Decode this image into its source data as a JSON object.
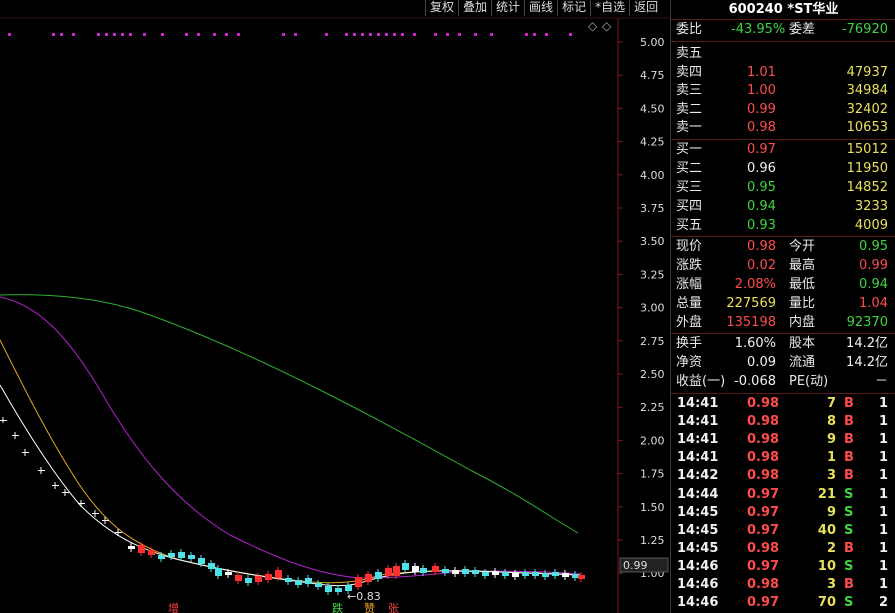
{
  "toolbar": [
    "复权",
    "叠加",
    "统计",
    "画线",
    "标记",
    "*自选",
    "返回"
  ],
  "chart_data": {
    "type": "line",
    "y_ticks": [
      "5.00",
      "4.75",
      "4.50",
      "4.25",
      "4.00",
      "3.75",
      "3.50",
      "3.25",
      "3.00",
      "2.75",
      "2.50",
      "2.25",
      "2.00",
      "1.75",
      "1.50",
      "1.25",
      "1.00"
    ],
    "current_price_label": "0.99",
    "low_marker": "←0.83",
    "bottom_tags": [
      "增",
      "跌",
      "赞",
      "张"
    ]
  },
  "header": {
    "code": "600240",
    "name": "*ST华业"
  },
  "weibi": {
    "label1": "委比",
    "value1": "-43.95%",
    "label2": "委差",
    "value2": "-76920"
  },
  "asks": [
    {
      "label": "卖五",
      "price": "",
      "vol": ""
    },
    {
      "label": "卖四",
      "price": "1.01",
      "vol": "47937"
    },
    {
      "label": "卖三",
      "price": "1.00",
      "vol": "34984"
    },
    {
      "label": "卖二",
      "price": "0.99",
      "vol": "32402"
    },
    {
      "label": "卖一",
      "price": "0.98",
      "vol": "10653"
    }
  ],
  "bids": [
    {
      "label": "买一",
      "price": "0.97",
      "vol": "15012"
    },
    {
      "label": "买二",
      "price": "0.96",
      "vol": "11950"
    },
    {
      "label": "买三",
      "price": "0.95",
      "vol": "14852"
    },
    {
      "label": "买四",
      "price": "0.94",
      "vol": "3233"
    },
    {
      "label": "买五",
      "price": "0.93",
      "vol": "4009"
    }
  ],
  "stats": [
    {
      "l1": "现价",
      "v1": "0.98",
      "l2": "今开",
      "v2": "0.95"
    },
    {
      "l1": "涨跌",
      "v1": "0.02",
      "l2": "最高",
      "v2": "0.99"
    },
    {
      "l1": "涨幅",
      "v1": "2.08%",
      "l2": "最低",
      "v2": "0.94"
    },
    {
      "l1": "总量",
      "v1": "227569",
      "l2": "量比",
      "v2": "1.04"
    },
    {
      "l1": "外盘",
      "v1": "135198",
      "l2": "内盘",
      "v2": "92370"
    }
  ],
  "stats2": [
    {
      "l1": "换手",
      "v1": "1.60%",
      "l2": "股本",
      "v2": "14.2亿"
    },
    {
      "l1": "净资",
      "v1": "0.09",
      "l2": "流通",
      "v2": "14.2亿"
    },
    {
      "l1": "收益(一)",
      "v1": "-0.068",
      "l2": "PE(动)",
      "v2": "－"
    }
  ],
  "ticks": [
    {
      "time": "14:41",
      "price": "0.98",
      "vol": "7",
      "side": "B",
      "n": "1"
    },
    {
      "time": "14:41",
      "price": "0.98",
      "vol": "8",
      "side": "B",
      "n": "1"
    },
    {
      "time": "14:41",
      "price": "0.98",
      "vol": "9",
      "side": "B",
      "n": "1"
    },
    {
      "time": "14:41",
      "price": "0.98",
      "vol": "1",
      "side": "B",
      "n": "1"
    },
    {
      "time": "14:42",
      "price": "0.98",
      "vol": "3",
      "side": "B",
      "n": "1"
    },
    {
      "time": "14:44",
      "price": "0.97",
      "vol": "21",
      "side": "S",
      "n": "1"
    },
    {
      "time": "14:45",
      "price": "0.97",
      "vol": "9",
      "side": "S",
      "n": "1"
    },
    {
      "time": "14:45",
      "price": "0.97",
      "vol": "40",
      "side": "S",
      "n": "1"
    },
    {
      "time": "14:45",
      "price": "0.98",
      "vol": "2",
      "side": "B",
      "n": "1"
    },
    {
      "time": "14:46",
      "price": "0.97",
      "vol": "10",
      "side": "S",
      "n": "1"
    },
    {
      "time": "14:46",
      "price": "0.98",
      "vol": "3",
      "side": "B",
      "n": "1"
    },
    {
      "time": "14:46",
      "price": "0.97",
      "vol": "70",
      "side": "S",
      "n": "2"
    }
  ]
}
